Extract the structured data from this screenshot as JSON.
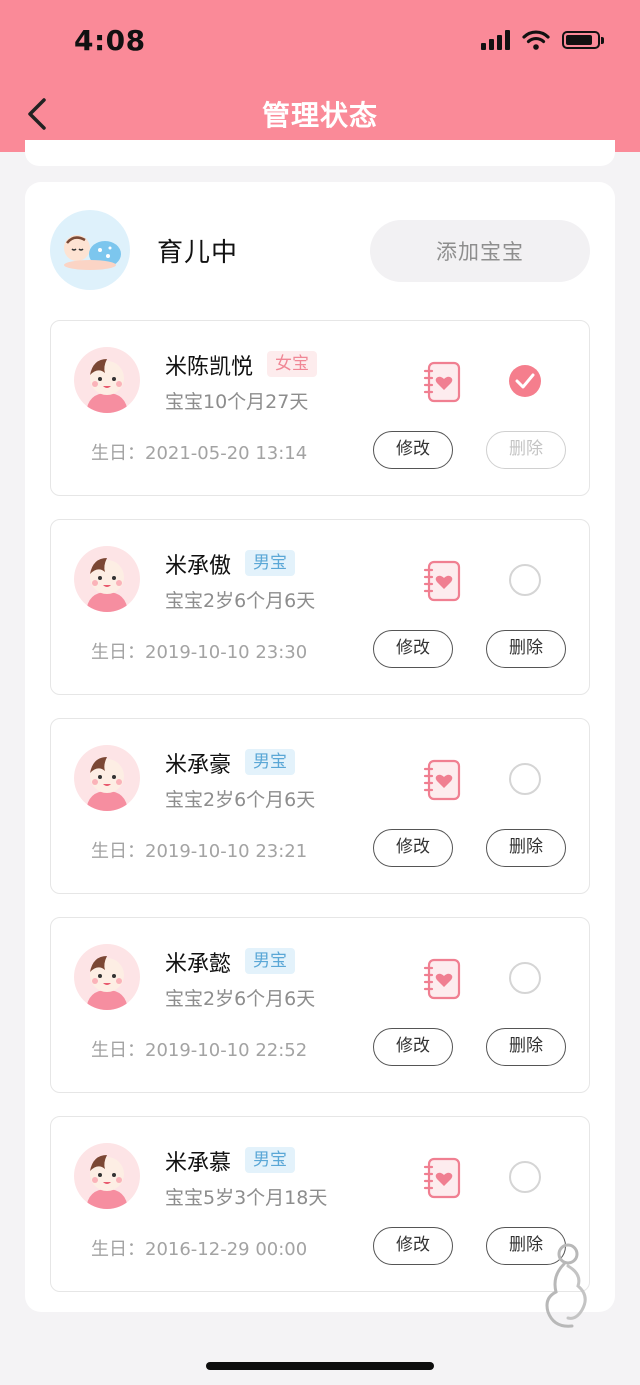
{
  "status_bar": {
    "time": "4:08"
  },
  "nav": {
    "title": "管理状态"
  },
  "state": {
    "title": "育儿中",
    "add_button": "添加宝宝"
  },
  "babies": [
    {
      "name": "米陈凯悦",
      "gender": "女宝",
      "age": "宝宝10个月27天",
      "birthday": "2021-05-20 13:14",
      "selected": true,
      "edit_label": "修改",
      "delete_label": "删除",
      "delete_enabled": false
    },
    {
      "name": "米承傲",
      "gender": "男宝",
      "age": "宝宝2岁6个月6天",
      "birthday": "2019-10-10 23:30",
      "selected": false,
      "edit_label": "修改",
      "delete_label": "删除",
      "delete_enabled": true
    },
    {
      "name": "米承豪",
      "gender": "男宝",
      "age": "宝宝2岁6个月6天",
      "birthday": "2019-10-10 23:21",
      "selected": false,
      "edit_label": "修改",
      "delete_label": "删除",
      "delete_enabled": true
    },
    {
      "name": "米承懿",
      "gender": "男宝",
      "age": "宝宝2岁6个月6天",
      "birthday": "2019-10-10 22:52",
      "selected": false,
      "edit_label": "修改",
      "delete_label": "删除",
      "delete_enabled": true
    },
    {
      "name": "米承慕",
      "gender": "男宝",
      "age": "宝宝5岁3个月18天",
      "birthday": "2016-12-29 00:00",
      "selected": false,
      "edit_label": "修改",
      "delete_label": "删除",
      "delete_enabled": true
    }
  ],
  "labels": {
    "birthday_prefix": "生日："
  },
  "colors": {
    "header": "#fa8a98",
    "accent": "#f57e8d",
    "girl_tag": "#f08795",
    "boy_tag": "#5aa7d6"
  },
  "icons": [
    "signal-icon",
    "wifi-icon",
    "battery-icon",
    "back-arrow-icon",
    "sleeping-baby-icon",
    "baby-avatar-icon",
    "notebook-heart-icon",
    "checkmark-icon",
    "pregnant-woman-logo-icon"
  ]
}
